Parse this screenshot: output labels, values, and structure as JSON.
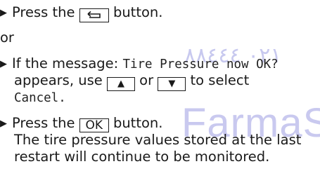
{
  "watermark": {
    "arabic": "٠٢١ ٨٨٤٤٤",
    "brand": "FarmaS"
  },
  "step1": {
    "pre": "Press the",
    "post": "button."
  },
  "or_text": "or",
  "step2": {
    "pre": "If the message:",
    "message": "Tire Pressure now OK?",
    "line2_pre": "appears, use",
    "or": "or",
    "line2_post": "to select",
    "option": "Cancel."
  },
  "step3": {
    "pre": "Press the",
    "ok_label": "OK",
    "post": "button.",
    "result_line1": "The tire pressure values stored at the last",
    "result_line2": "restart will continue to be monitored."
  },
  "symbols": {
    "bullet": "▶",
    "up": "▲",
    "down": "▼"
  }
}
